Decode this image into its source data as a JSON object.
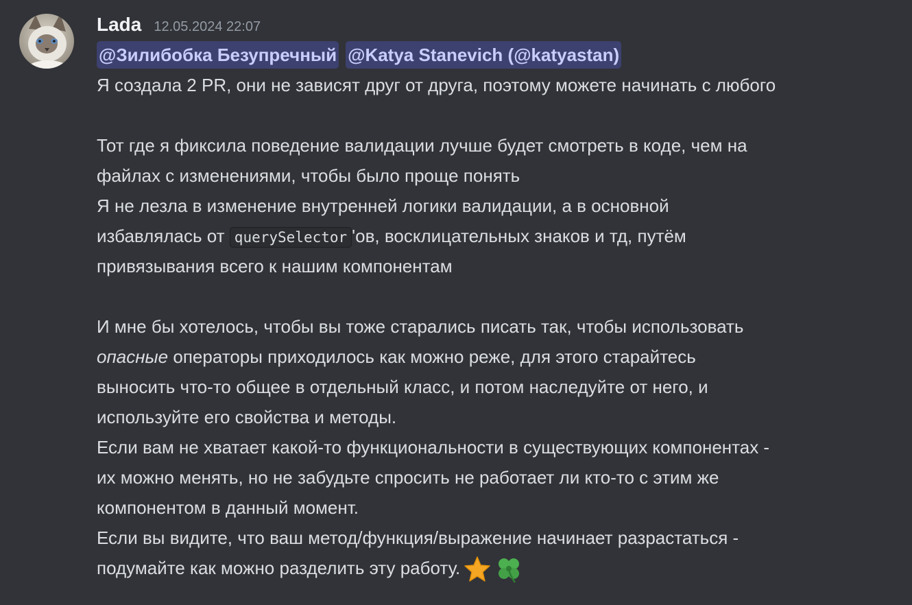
{
  "message": {
    "username": "Lada",
    "timestamp": "12.05.2024 22:07",
    "mentions": [
      "@Зилибобка Безупречный",
      "@Katya Stanevich (@katyastan)"
    ],
    "line1": "Я создала 2 PR, они не зависят друг от друга, поэтому можете начинать с любого",
    "line2": "Тот где я фиксила поведение валидации лучше будет смотреть в коде, чем на",
    "line3": "файлах с изменениями, чтобы было проще понять",
    "line4": "Я не лезла в изменение внутренней логики валидации, а в основной",
    "line5_before": "избавлялась от ",
    "line5_code": "querySelector",
    "line5_after": "'ов, восклицательных знаков и тд, путём",
    "line6": "привязывания всего к нашим компонентам",
    "line7": "И мне бы хотелось, чтобы вы тоже старались писать так, чтобы использовать",
    "line8_italic": "опасные",
    "line8_after": " операторы приходилось как можно реже, для этого старайтесь",
    "line9": "выносить что-то общее в отдельный класс, и потом наследуйте от него, и",
    "line10": "используйте его свойства и методы.",
    "line11": "Если вам не хватает какой-то функциональности в существующих компонентах -",
    "line12": "их можно менять, но не забудьте спросить не работает ли кто-то с этим же",
    "line13": "компонентом в данный момент.",
    "line14": "Если вы видите, что ваш метод/функция/выражение начинает разрастаться -",
    "line15": "подумайте как можно разделить эту работу.",
    "emojis": [
      "star-emoji",
      "four-leaf-clover-emoji"
    ]
  },
  "colors": {
    "background": "#313338",
    "text": "#dbdee1",
    "username": "#f2f3f5",
    "timestamp": "#949ba4",
    "mention_text": "#c9cdfb",
    "mention_bg": "rgba(88,101,242,0.3)"
  }
}
